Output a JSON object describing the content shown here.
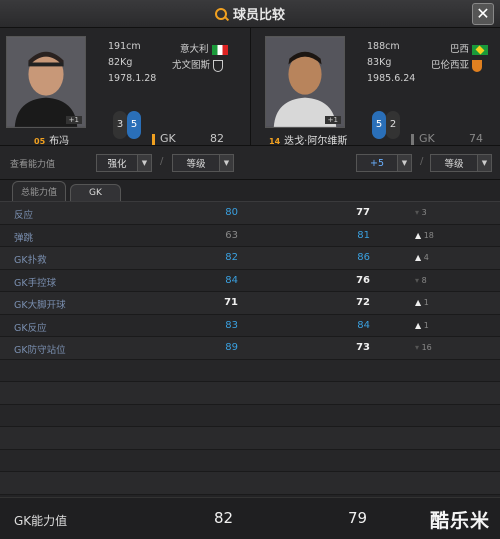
{
  "window": {
    "title": "球员比较",
    "close": "✕"
  },
  "left": {
    "name": "布冯",
    "number": "05",
    "height": "191cm",
    "weight": "82Kg",
    "birth": "1978.1.28",
    "country": "意大利",
    "club": "尤文图斯",
    "photo_tag": "+1",
    "chip_a": "3",
    "chip_b": "5",
    "position": "GK",
    "rating": "82"
  },
  "right": {
    "name": "迭戈·阿尔维斯",
    "number": "14",
    "height": "188cm",
    "weight": "83Kg",
    "birth": "1985.6.24",
    "country": "巴西",
    "club": "巴伦西亚",
    "photo_tag": "+1",
    "chip_a": "5",
    "chip_b": "2",
    "position": "GK",
    "rating": "74"
  },
  "controls": {
    "view_label": "查看能力值",
    "left_enhance": "强化",
    "left_level": "等级",
    "right_enhance": "+5",
    "right_level": "等级",
    "slash": "/"
  },
  "tabs": [
    "总能力值",
    "GK"
  ],
  "rows": [
    {
      "label": "反应",
      "v1": "80",
      "v2": "77",
      "diff": "3",
      "dir": "down"
    },
    {
      "label": "弹跳",
      "v1": "63",
      "v2": "81",
      "diff": "18",
      "dir": "up"
    },
    {
      "label": "GK扑救",
      "v1": "82",
      "v2": "86",
      "diff": "4",
      "dir": "up"
    },
    {
      "label": "GK手控球",
      "v1": "84",
      "v2": "76",
      "diff": "8",
      "dir": "down"
    },
    {
      "label": "GK大脚开球",
      "v1": "71",
      "v2": "72",
      "diff": "1",
      "dir": "up"
    },
    {
      "label": "GK反应",
      "v1": "83",
      "v2": "84",
      "diff": "1",
      "dir": "up"
    },
    {
      "label": "GK防守站位",
      "v1": "89",
      "v2": "73",
      "diff": "16",
      "dir": "down"
    }
  ],
  "footer": {
    "label": "GK能力值",
    "v1": "82",
    "v2": "79",
    "watermark": "酷乐米"
  },
  "colors": {
    "accent": "#f0a020",
    "blue": "#3aa0e0"
  }
}
